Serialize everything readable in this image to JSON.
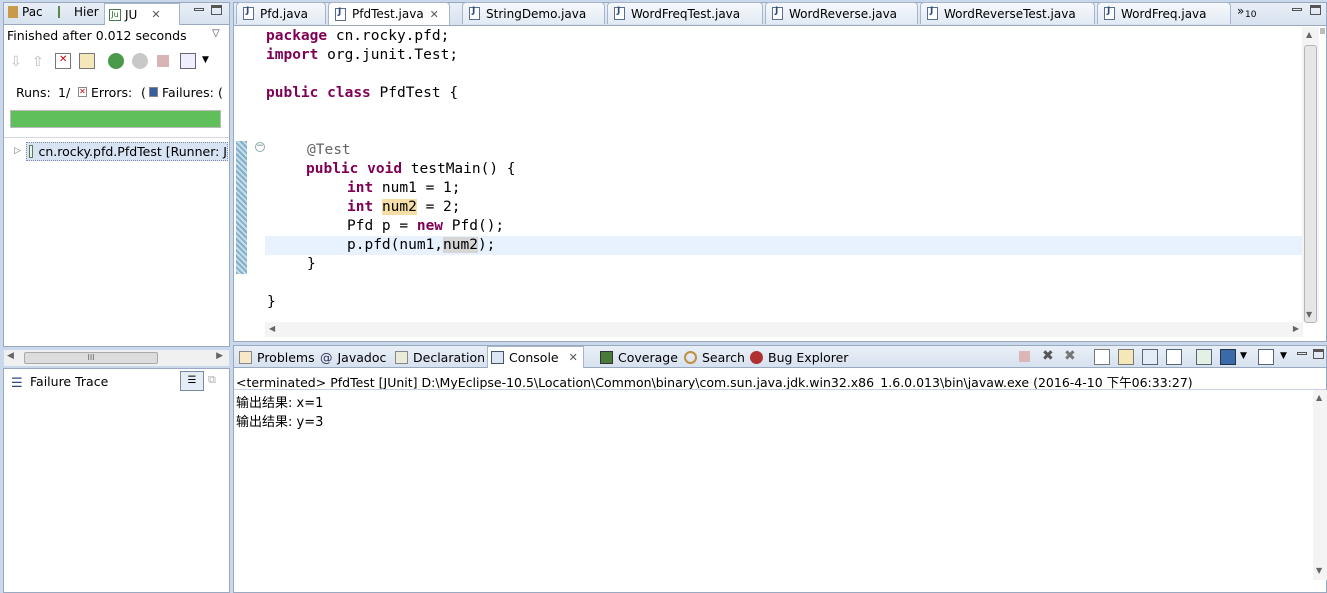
{
  "left_panel": {
    "tabs": [
      {
        "label": "Pac"
      },
      {
        "label": "Hier"
      },
      {
        "label": "JU"
      }
    ],
    "status": "Finished after 0.012 seconds",
    "runs_label": "Runs:",
    "runs_value": "1/",
    "errors_label": "Errors:",
    "errors_value": "(",
    "failures_label": "Failures:",
    "failures_value": "(",
    "progress": 1.0,
    "progress_color": "#5fbf5a",
    "tree_item": "cn.rocky.pfd.PfdTest [Runner: J",
    "failure_trace_label": "Failure Trace",
    "scroll_mark": "III"
  },
  "editor": {
    "tabs": [
      {
        "label": "Pfd.java"
      },
      {
        "label": "PfdTest.java"
      },
      {
        "label": "StringDemo.java"
      },
      {
        "label": "WordFreqTest.java"
      },
      {
        "label": "WordReverse.java"
      },
      {
        "label": "WordReverseTest.java"
      },
      {
        "label": "WordFreq.java"
      }
    ],
    "overflow_count": "10",
    "code": {
      "l1_kw": "package",
      "l1_rest": " cn.rocky.pfd;",
      "l2_kw": "import",
      "l2_rest": " org.junit.Test;",
      "l3_kw1": "public",
      "l3_kw2": "class",
      "l3_rest": " PfdTest {",
      "l4_ann": "@Test",
      "l5_kw1": "public",
      "l5_kw2": "void",
      "l5_rest": " testMain() {",
      "l6_kw": "int",
      "l6_rest": " num1 = 1;",
      "l7_kw": "int",
      "l7_var": "num2",
      "l7_rest": " = 2;",
      "l8_pre": "Pfd p = ",
      "l8_kw": "new",
      "l8_rest": " Pfd();",
      "l9_pre": "p.pfd(num1,",
      "l9_var": "num2",
      "l9_rest": ");",
      "l10": "}",
      "l11": "}"
    }
  },
  "bottom": {
    "tabs": [
      {
        "label": "Problems"
      },
      {
        "label": "Javadoc"
      },
      {
        "label": "Declaration"
      },
      {
        "label": "Console"
      },
      {
        "label": "Coverage"
      },
      {
        "label": "Search"
      },
      {
        "label": "Bug Explorer"
      }
    ],
    "console_header": "<terminated> PfdTest [JUnit] D:\\MyEclipse-10.5\\Location\\Common\\binary\\com.sun.java.jdk.win32.x86_1.6.0.013\\bin\\javaw.exe (2016-4-10 下午06:33:27)",
    "output": [
      "输出结果: x=1",
      "输出结果: y=3"
    ]
  }
}
